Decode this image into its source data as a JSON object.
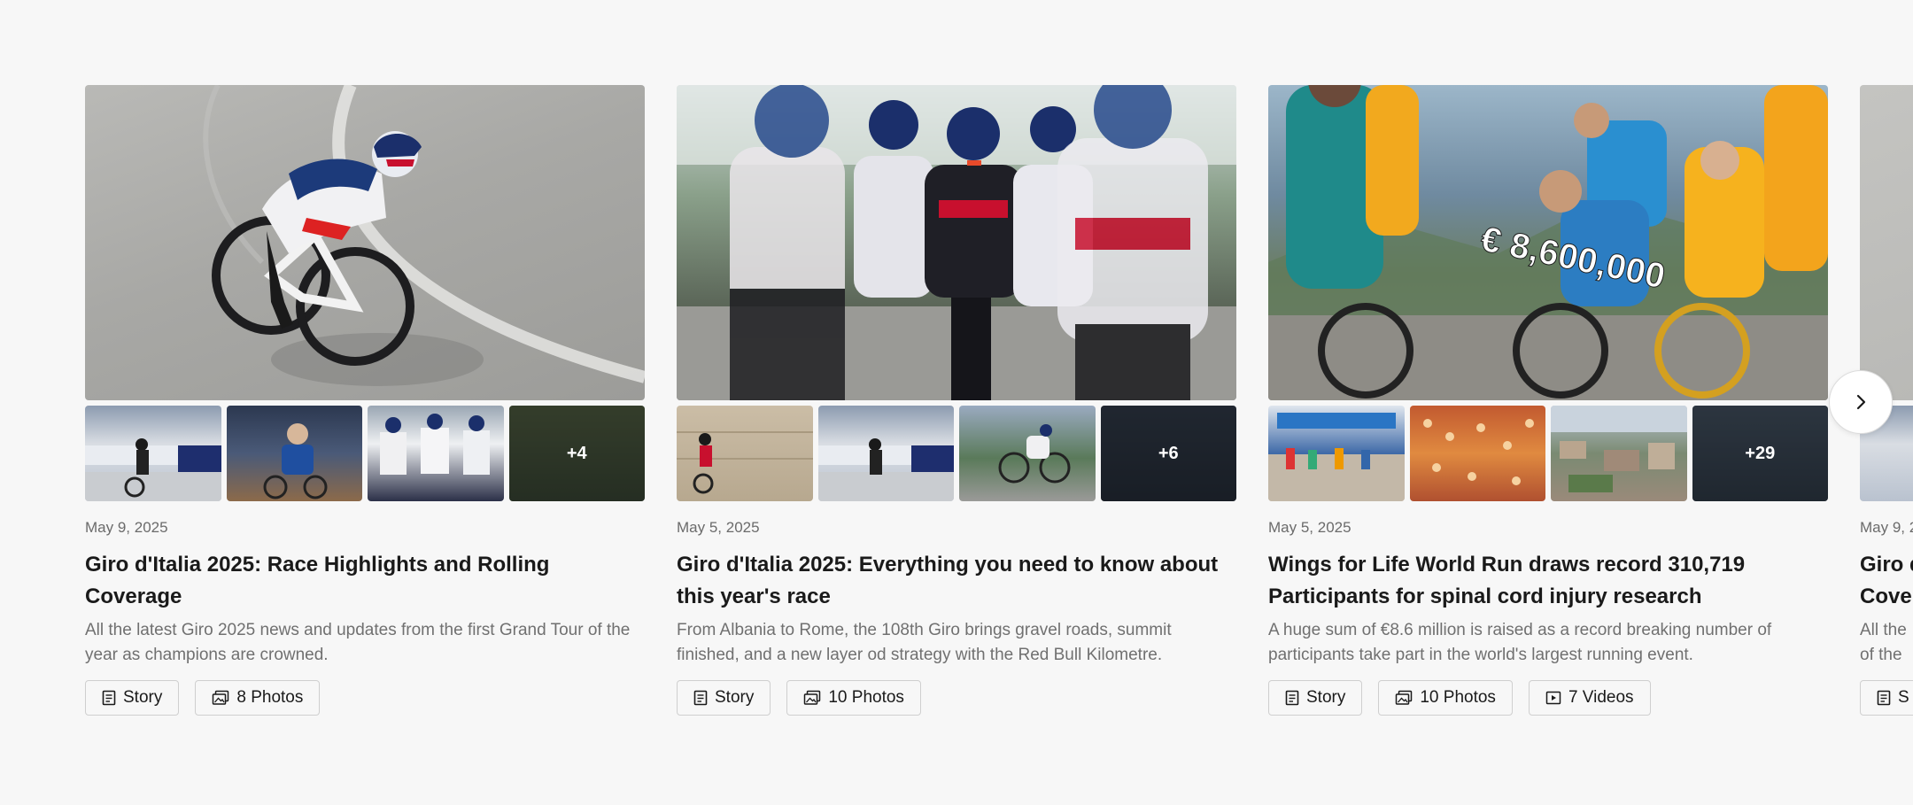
{
  "carousel": {
    "next_icon": "chevron-right-icon",
    "cards": [
      {
        "date": "May 9, 2025",
        "title": "Giro d'Italia 2025: Race Highlights and Rolling Coverage",
        "description": "All the latest Giro 2025 news and updates from the first Grand Tour of the year as champions are crowned.",
        "more_count": "+4",
        "chips": [
          {
            "icon": "story-icon",
            "label": "Story"
          },
          {
            "icon": "photos-icon",
            "label": "8 Photos"
          }
        ]
      },
      {
        "date": "May 5, 2025",
        "title": "Giro d'Italia 2025: Everything you need to know about this year's race",
        "description": "From Albania to Rome, the 108th Giro brings gravel roads, summit finished, and a new layer od strategy with the Red Bull Kilometre.",
        "more_count": "+6",
        "chips": [
          {
            "icon": "story-icon",
            "label": "Story"
          },
          {
            "icon": "photos-icon",
            "label": "10 Photos"
          }
        ]
      },
      {
        "date": "May 5, 2025",
        "title": "Wings for Life World Run draws record 310,719 Participants for spinal cord injury research",
        "description": "A huge sum of €8.6 million is raised as a record breaking number of participants take part in the world's largest running event.",
        "hero_overlay_text": "€ 8,600,000",
        "more_count": "+29",
        "chips": [
          {
            "icon": "story-icon",
            "label": "Story"
          },
          {
            "icon": "photos-icon",
            "label": "10 Photos"
          },
          {
            "icon": "video-icon",
            "label": "7 Videos"
          }
        ]
      },
      {
        "date": "May 9, 2",
        "title": "Giro d",
        "title_line2": "Cove",
        "description": "All the",
        "description_line2": "of the",
        "chips": [
          {
            "icon": "story-icon",
            "label": "S"
          }
        ]
      }
    ]
  }
}
